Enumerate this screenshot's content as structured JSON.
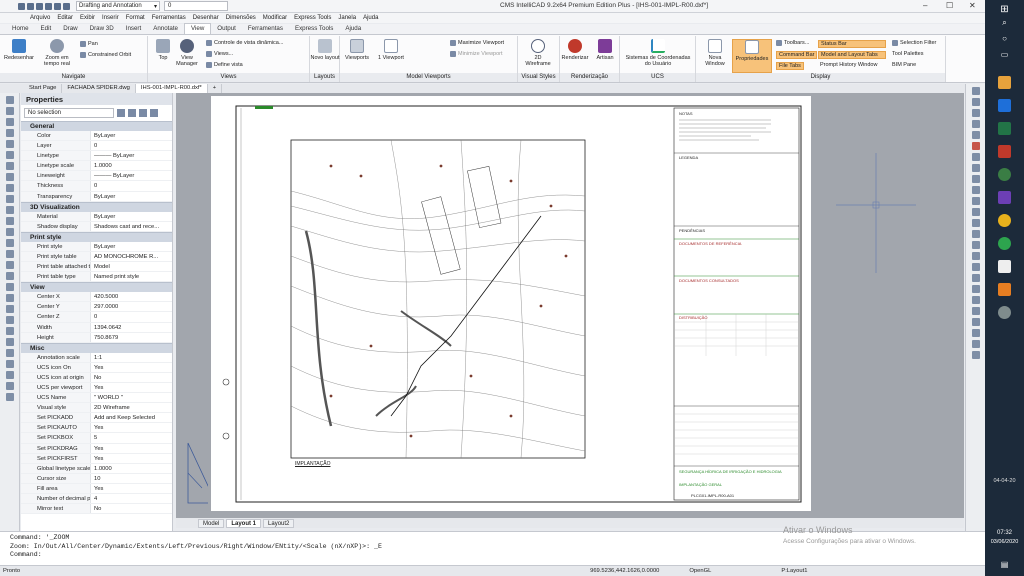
{
  "titlebar": {
    "workspace": "Drafting and Annotation",
    "layer_value": "0",
    "title": "CMS IntelliCAD 9.2x64 Premium Edition Plus - [IHS-001-IMPL-R00.dxf*]",
    "min": "–",
    "max": "☐",
    "close": "✕"
  },
  "menu": [
    "Arquivo",
    "Editar",
    "Exibir",
    "Inserir",
    "Format",
    "Ferramentas",
    "Desenhar",
    "Dimensões",
    "Modificar",
    "Express Tools",
    "Janela",
    "Ajuda"
  ],
  "ribbon_tabs": [
    "Home",
    "Edit",
    "Draw",
    "Draw 3D",
    "Insert",
    "Annotate",
    "View",
    "Output",
    "Ferramentas",
    "Express Tools",
    "Ajuda"
  ],
  "ribbon_active_tab": "View",
  "ribbon": {
    "navigate": {
      "label": "Navigate",
      "redesenhar": "Redesenhar",
      "zoom": "Zoom em tempo real",
      "pan": "Pan",
      "orbit": "Constrained Orbit"
    },
    "views": {
      "label": "Views",
      "top": "Top",
      "view_manager": "View Manager",
      "controle": "Controle de vista dinâmica...",
      "views": "Views...",
      "define": "Define vista"
    },
    "layouts": {
      "label": "Layouts",
      "novo": "Novo layout"
    },
    "model_viewports": {
      "label": "Model Viewports",
      "viewports": "Viewports",
      "one_viewport": "1 Viewport",
      "maximize": "Maximize Viewport",
      "minimize": "Minimize Viewport"
    },
    "visual_styles": {
      "label": "Visual Styles",
      "wireframe": "2D Wireframe"
    },
    "render": {
      "label": "Renderização",
      "renderizar": "Renderizar",
      "artisan": "Artisan"
    },
    "ucs": {
      "label": "UCS",
      "sistemas": "Sistemas de Coordenadas do Usuário"
    },
    "display": {
      "label": "Display",
      "novo_window": "Nova Window",
      "propriedades": "Propriedades",
      "toolbars": "Toolbars...",
      "command_bar": "Command Bar",
      "file_tabs": "File Tabs",
      "status_bar": "Status Bar",
      "model_layout_tabs": "Model and Layout Tabs",
      "prompt_history": "Prompt History Window",
      "selection_filter": "Selection Filter",
      "tool_palettes": "Tool Palettes",
      "bim_pane": "BIM Pane"
    }
  },
  "doc_tabs": [
    "Start Page",
    "FACHADA SPIDER.dwg",
    "IHS-001-IMPL-R00.dxf*"
  ],
  "properties": {
    "title": "Properties",
    "selection": "No selection",
    "sections": [
      {
        "name": "General",
        "rows": [
          [
            "Color",
            "ByLayer"
          ],
          [
            "Layer",
            "0"
          ],
          [
            "Linetype",
            "——— ByLayer"
          ],
          [
            "Linetype scale",
            "1.0000"
          ],
          [
            "Lineweight",
            "——— ByLayer"
          ],
          [
            "Thickness",
            "0"
          ],
          [
            "Transparency",
            "ByLayer"
          ]
        ]
      },
      {
        "name": "3D Visualization",
        "rows": [
          [
            "Material",
            "ByLayer"
          ],
          [
            "Shadow display",
            "Shadows cast and rece..."
          ]
        ]
      },
      {
        "name": "Print style",
        "rows": [
          [
            "Print style",
            "ByLayer"
          ],
          [
            "Print style table",
            "AD MONOCHROME R..."
          ],
          [
            "Print table attached to",
            "Model"
          ],
          [
            "Print table type",
            "Named print style"
          ]
        ]
      },
      {
        "name": "View",
        "rows": [
          [
            "Center X",
            "420.5000"
          ],
          [
            "Center Y",
            "297.0000"
          ],
          [
            "Center Z",
            "0"
          ],
          [
            "Width",
            "1394.0642"
          ],
          [
            "Height",
            "750.8679"
          ]
        ]
      },
      {
        "name": "Misc",
        "rows": [
          [
            "Annotation scale",
            "1:1"
          ],
          [
            "UCS icon On",
            "Yes"
          ],
          [
            "UCS icon at origin",
            "No"
          ],
          [
            "UCS per viewport",
            "Yes"
          ],
          [
            "UCS Name",
            "\" WORLD \""
          ],
          [
            "Visual style",
            "2D Wireframe"
          ],
          [
            "Set PICKADD",
            "Add and Keep Selected"
          ],
          [
            "Set PICKAUTO",
            "Yes"
          ],
          [
            "Set PICKBOX",
            "5"
          ],
          [
            "Set PICKDRAG",
            "Yes"
          ],
          [
            "Set PICKFIRST",
            "Yes"
          ],
          [
            "Global linetype scale",
            "1.0000"
          ],
          [
            "Cursor size",
            "10"
          ],
          [
            "Fill area",
            "Yes"
          ],
          [
            "Number of decimal plac...",
            "4"
          ],
          [
            "Mirror text",
            "No"
          ]
        ]
      }
    ]
  },
  "drawing": {
    "notes_title": "NOTAS",
    "legenda": "LEGENDA",
    "pendencias": "PENDÊNCIAS",
    "doc_ref": "DOCUMENTOS DE REFERÊNCIA",
    "doc_cons": "DOCUMENTOS CONSULTADOS",
    "distrib": "DISTRIBUIÇÃO",
    "title_block": "SEGURANÇA HÍDRICA DE IRRIGAÇÃO E HIDROLOGIA",
    "implantacao": "IMPLANTAÇÃO GERAL",
    "sheet_code": "PLCG01-IMPL-R00-A01",
    "plan_label": "IMPLANTAÇÃO"
  },
  "layout_tabs": [
    "Model",
    "Layout 1",
    "Layout2"
  ],
  "layout_active": "Layout 1",
  "command": {
    "line1": "Command: '_ZOOM",
    "line2": "Zoom:  In/Out/All/Center/Dynamic/Extents/Left/Previous/Right/Window/ENtity/<Scale (nX/nXP)>: _E",
    "line3": "Command:"
  },
  "status": {
    "left": "Pronto",
    "coords": "969.5236,442.1626,0.0000",
    "opengl": "OpenGL",
    "layout": "P:Layout1"
  },
  "watermark": {
    "line1": "Ativar o Windows",
    "line2": "Acesse Configurações para ativar o Windows."
  },
  "taskbar": {
    "time": "07:32",
    "date": "03/06/2020",
    "date_small": "04-04-20"
  }
}
